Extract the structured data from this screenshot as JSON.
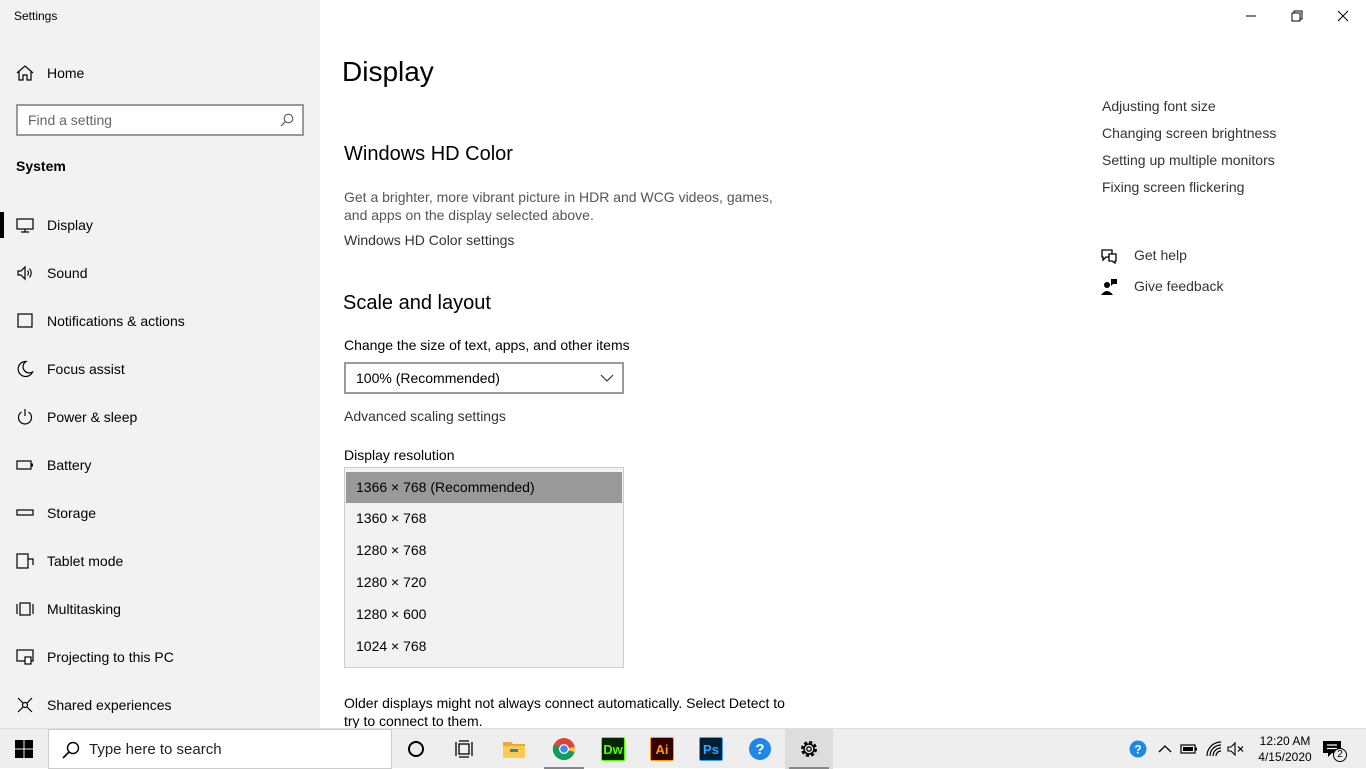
{
  "app": {
    "title": "Settings"
  },
  "sidebar": {
    "home_label": "Home",
    "search_placeholder": "Find a setting",
    "section": "System",
    "items": [
      {
        "label": "Display",
        "icon": "monitor-icon"
      },
      {
        "label": "Sound",
        "icon": "speaker-icon"
      },
      {
        "label": "Notifications & actions",
        "icon": "notification-icon"
      },
      {
        "label": "Focus assist",
        "icon": "moon-icon"
      },
      {
        "label": "Power & sleep",
        "icon": "power-icon"
      },
      {
        "label": "Battery",
        "icon": "battery-icon"
      },
      {
        "label": "Storage",
        "icon": "storage-icon"
      },
      {
        "label": "Tablet mode",
        "icon": "tablet-icon"
      },
      {
        "label": "Multitasking",
        "icon": "multitasking-icon"
      },
      {
        "label": "Projecting to this PC",
        "icon": "projector-icon"
      },
      {
        "label": "Shared experiences",
        "icon": "shared-experiences-icon"
      }
    ]
  },
  "main": {
    "title": "Display",
    "hd_color": {
      "heading": "Windows HD Color",
      "description": "Get a brighter, more vibrant picture in HDR and WCG videos, games, and apps on the display selected above.",
      "link": "Windows HD Color settings"
    },
    "scale": {
      "heading": "Scale and layout",
      "size_label": "Change the size of text, apps, and other items",
      "size_value": "100% (Recommended)",
      "advanced_link": "Advanced scaling settings",
      "resolution_label": "Display resolution",
      "resolution_options": [
        "1366 × 768 (Recommended)",
        "1360 × 768",
        "1280 × 768",
        "1280 × 720",
        "1280 × 600",
        "1024 × 768"
      ],
      "selected_index": 0
    },
    "bottom_text": "Older displays might not always connect automatically. Select Detect to try to connect to them."
  },
  "related": {
    "links": [
      "Adjusting font size",
      "Changing screen brightness",
      "Setting up multiple monitors",
      "Fixing screen flickering"
    ],
    "get_help": "Get help",
    "give_feedback": "Give feedback"
  },
  "taskbar": {
    "search_placeholder": "Type here to search",
    "apps": [
      {
        "name": "Dw",
        "bg": "#072401",
        "fg": "#4cff00"
      },
      {
        "name": "Ai",
        "bg": "#330000",
        "fg": "#ff9a00"
      },
      {
        "name": "Ps",
        "bg": "#001e36",
        "fg": "#31a8ff"
      }
    ],
    "time": "12:20 AM",
    "date": "4/15/2020",
    "notification_count": "2"
  }
}
